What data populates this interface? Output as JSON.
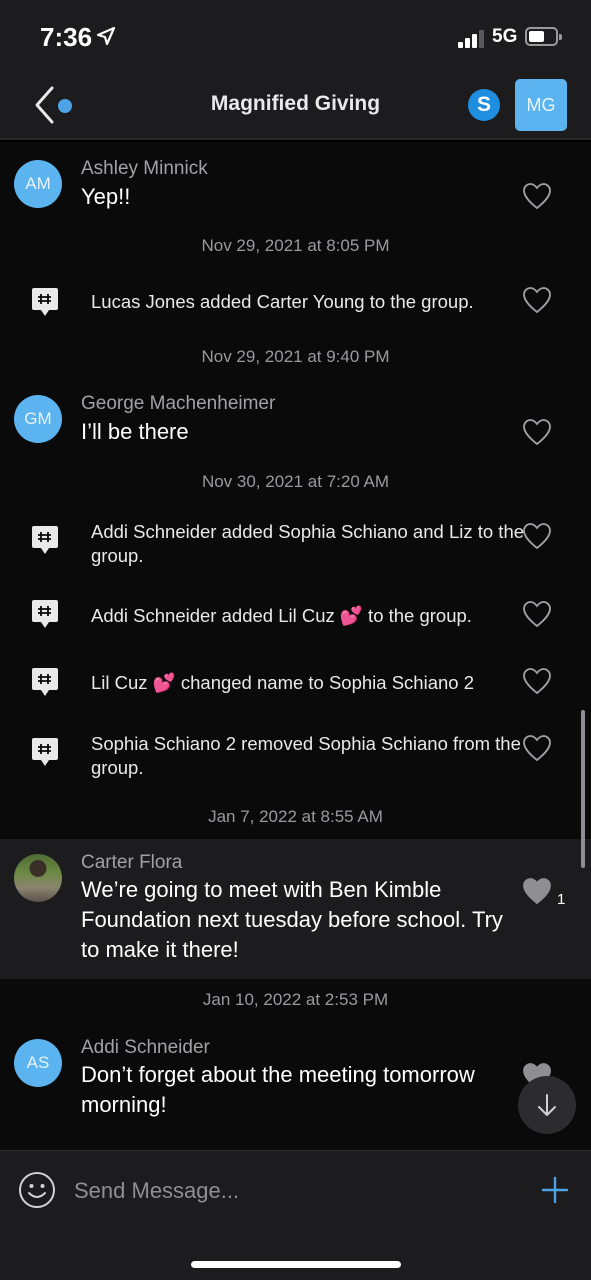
{
  "status_bar": {
    "time": "7:36",
    "network": "5G",
    "location_icon": "location-arrow-icon",
    "signal_bars_filled": 3,
    "signal_bars_total": 4
  },
  "nav": {
    "back_icon": "chevron-left-icon",
    "title": "Magnified Giving",
    "skype_label": "S",
    "group_avatar": "MG"
  },
  "messages": [
    {
      "type": "user",
      "avatar": "AM",
      "sender": "Ashley Minnick",
      "text": "Yep!!",
      "liked": false
    },
    {
      "type": "timestamp",
      "text": "Nov 29, 2021 at 8:05 PM"
    },
    {
      "type": "system",
      "text": "Lucas Jones added Carter Young to the group."
    },
    {
      "type": "timestamp",
      "text": "Nov 29, 2021 at 9:40 PM"
    },
    {
      "type": "user",
      "avatar": "GM",
      "sender": "George Machenheimer",
      "text": "I’ll be there",
      "liked": false
    },
    {
      "type": "timestamp",
      "text": "Nov 30, 2021 at 7:20 AM"
    },
    {
      "type": "system",
      "text": "Addi Schneider added Sophia Schiano and Liz to the group."
    },
    {
      "type": "system",
      "text": "Addi Schneider added Lil Cuz 💕 to the group."
    },
    {
      "type": "system",
      "text": "Lil Cuz 💕 changed name to Sophia Schiano 2"
    },
    {
      "type": "system",
      "text": "Sophia Schiano 2 removed Sophia Schiano from the group."
    },
    {
      "type": "timestamp",
      "text": "Jan 7, 2022 at 8:55 AM"
    },
    {
      "type": "user",
      "avatar": "photo",
      "sender": "Carter Flora",
      "text": "We’re going to meet with Ben Kimble Foundation next tuesday before school. Try to make it there!",
      "liked": true,
      "like_count": "1"
    },
    {
      "type": "timestamp",
      "text": "Jan 10, 2022 at 2:53 PM"
    },
    {
      "type": "user",
      "avatar": "AS",
      "sender": "Addi Schneider",
      "text": "Don’t forget about the meeting tomorrow morning!",
      "liked": true
    }
  ],
  "composer": {
    "placeholder": "Send Message...",
    "emoji_icon": "smiley-face-icon",
    "add_icon": "plus-icon"
  },
  "colors": {
    "accent": "#5bb4ef",
    "background": "#000000",
    "bar": "#1c1c1e"
  }
}
